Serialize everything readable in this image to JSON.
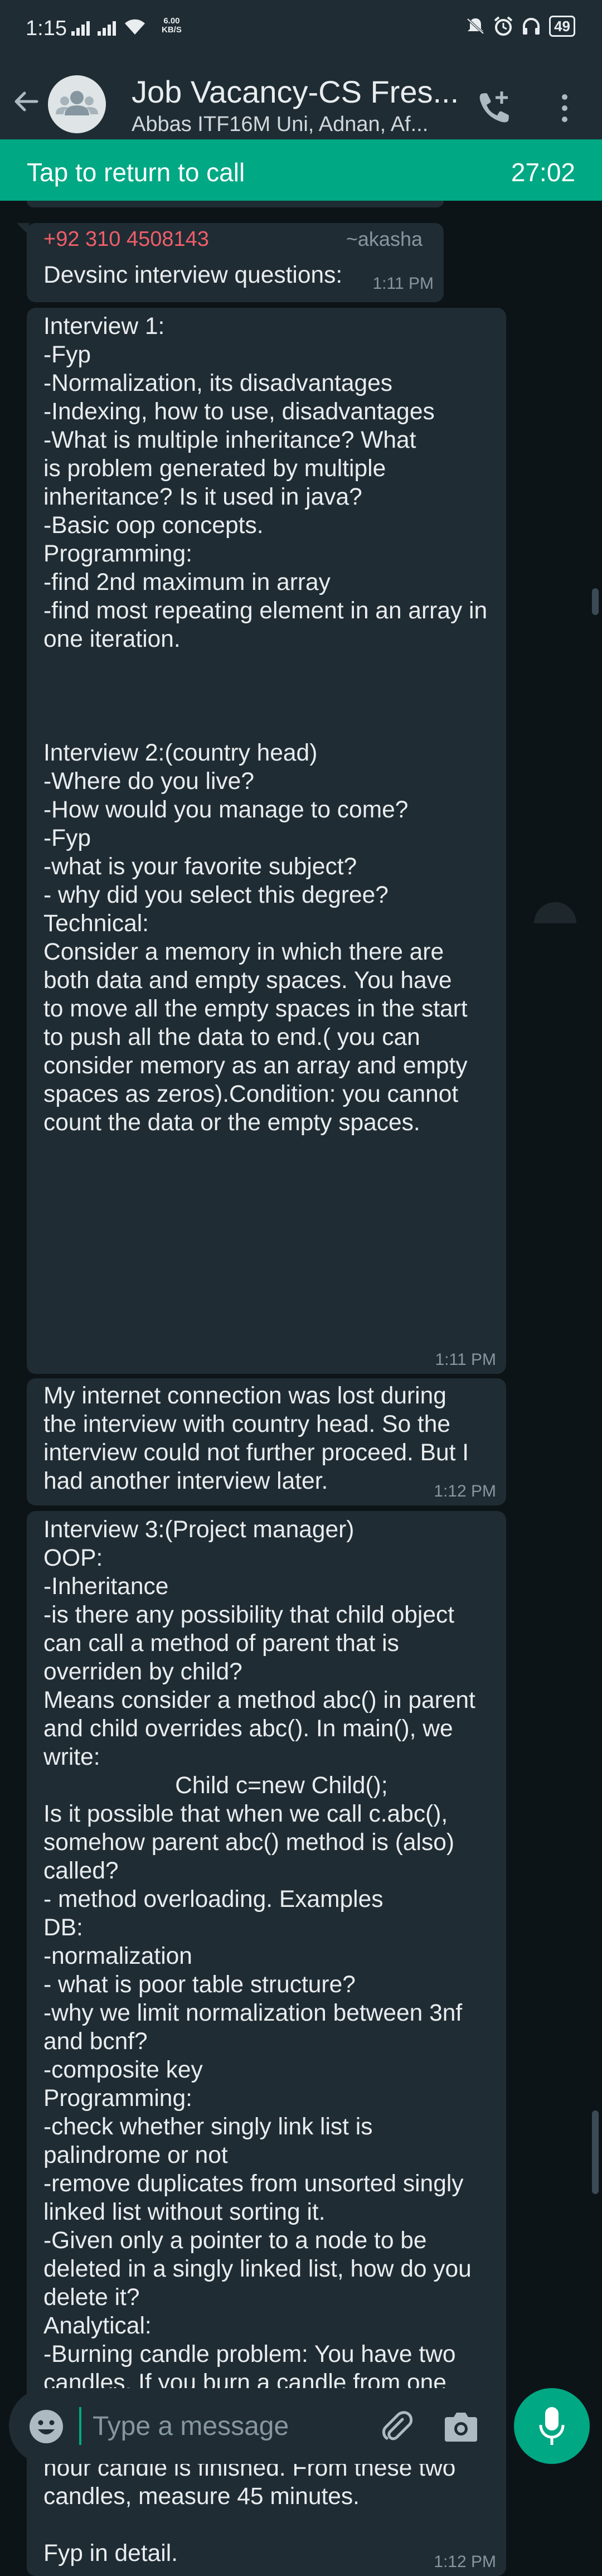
{
  "status_bar": {
    "time": "1:15",
    "speed_value": "6.00",
    "speed_unit": "KB/S",
    "battery": "49"
  },
  "header": {
    "title": "Job Vacancy-CS Fres...",
    "subtitle": "Abbas ITF16M Uni, Adnan, Af...",
    "back_icon": "arrow-left-icon",
    "add_call_icon": "phone-plus-icon",
    "menu_icon": "vertical-dots-icon"
  },
  "call_banner": {
    "text": "Tap to return to call",
    "timer": "27:02",
    "color": "#00a884"
  },
  "messages": [
    {
      "sender_phone": "+92 310 4508143",
      "sender_alias": "~akasha",
      "text": "Devsinc interview questions:",
      "time": "1:11 PM"
    },
    {
      "text": "Interview 1:\n-Fyp\n-Normalization, its disadvantages\n-Indexing, how to use, disadvantages\n-What is multiple inheritance? What\nis problem generated by multiple\ninheritance? Is it used in java?\n-Basic oop concepts.\nProgramming:\n-find 2nd maximum in array\n-find most repeating element in an array in\none iteration.\n\n\n\nInterview 2:(country head)\n-Where do you live?\n-How would you manage to come?\n-Fyp\n-what is your favorite subject?\n- why did you select this degree?\nTechnical:\nConsider a memory in which there are\nboth data and empty spaces. You have\nto move all the empty spaces in the start\nto push all the data to end.( you can\nconsider memory as an array and empty\nspaces as zeros).Condition: you cannot\ncount the data or the empty spaces.",
      "time": "1:11 PM"
    },
    {
      "text": "My internet connection was lost during\nthe interview with country head. So the\ninterview could not further proceed. But I\nhad another interview later.",
      "time": "1:12 PM"
    },
    {
      "text": "Interview 3:(Project manager)\nOOP:\n-Inheritance\n-is there any possibility that child object\ncan call a method of parent that is\noverriden by child?\nMeans consider a method abc() in parent\nand child overrides abc(). In main(), we\nwrite:\n                    Child c=new Child();\nIs it possible that when we call c.abc(),\nsomehow parent abc() method is (also)\ncalled?\n- method overloading. Examples\nDB:\n-normalization\n- what is poor table structure?\n-why we limit normalization between 3nf\nand bcnf?\n-composite key\nProgramming:\n-check whether singly link list is\npalindrome or not\n-remove duplicates from unsorted singly\nlinked list without sorting it.\n-Given only a pointer to a node to be\ndeleted in a singly linked list, how do you\ndelete it?\nAnalytical:\n-Burning candle problem: You have two\ncandles. If you burn a candle from one\nside, it takes 1 hour to completely burn.\nAnd if you burn from both sides, in half\nhour candle is finished. From these two\ncandles, measure 45 minutes.\n\nFyp in detail.",
      "time": "1:12 PM"
    }
  ],
  "composer": {
    "placeholder": "Type a message",
    "emoji_icon": "smiley-icon",
    "attach_icon": "paperclip-icon",
    "camera_icon": "camera-icon",
    "mic_icon": "microphone-icon"
  }
}
